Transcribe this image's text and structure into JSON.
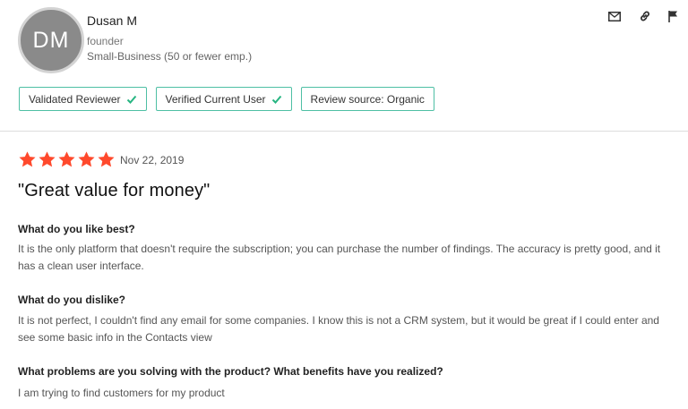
{
  "reviewer": {
    "initials": "DM",
    "name": "Dusan M",
    "role": "founder",
    "company_size": "Small-Business (50 or fewer emp.)"
  },
  "actions": {
    "icons": [
      "mail-icon",
      "link-icon",
      "flag-icon"
    ]
  },
  "badges": [
    {
      "label": "Validated Reviewer",
      "check": true
    },
    {
      "label": "Verified Current User",
      "check": true
    },
    {
      "label": "Review source: Organic",
      "check": false
    }
  ],
  "review": {
    "rating": 5,
    "date": "Nov 22, 2019",
    "title": "\"Great value for money\"",
    "sections": [
      {
        "question": "What do you like best?",
        "answer": "It is the only platform that doesn't require the subscription; you can purchase the number of findings. The accuracy is pretty good, and it has a clean user interface."
      },
      {
        "question": "What do you dislike?",
        "answer": "It is not perfect, I couldn't find any email for some companies. I know this is not a CRM system, but it would be great if I could enter and see some basic info in the Contacts view"
      },
      {
        "question": "What problems are you solving with the product? What benefits have you realized?",
        "answer": "I am trying to find customers for my product"
      }
    ]
  },
  "colors": {
    "star": "#ff492c",
    "badge_border": "#4ebfa4",
    "check": "#27b582",
    "avatar_bg": "#8a8a8a"
  }
}
